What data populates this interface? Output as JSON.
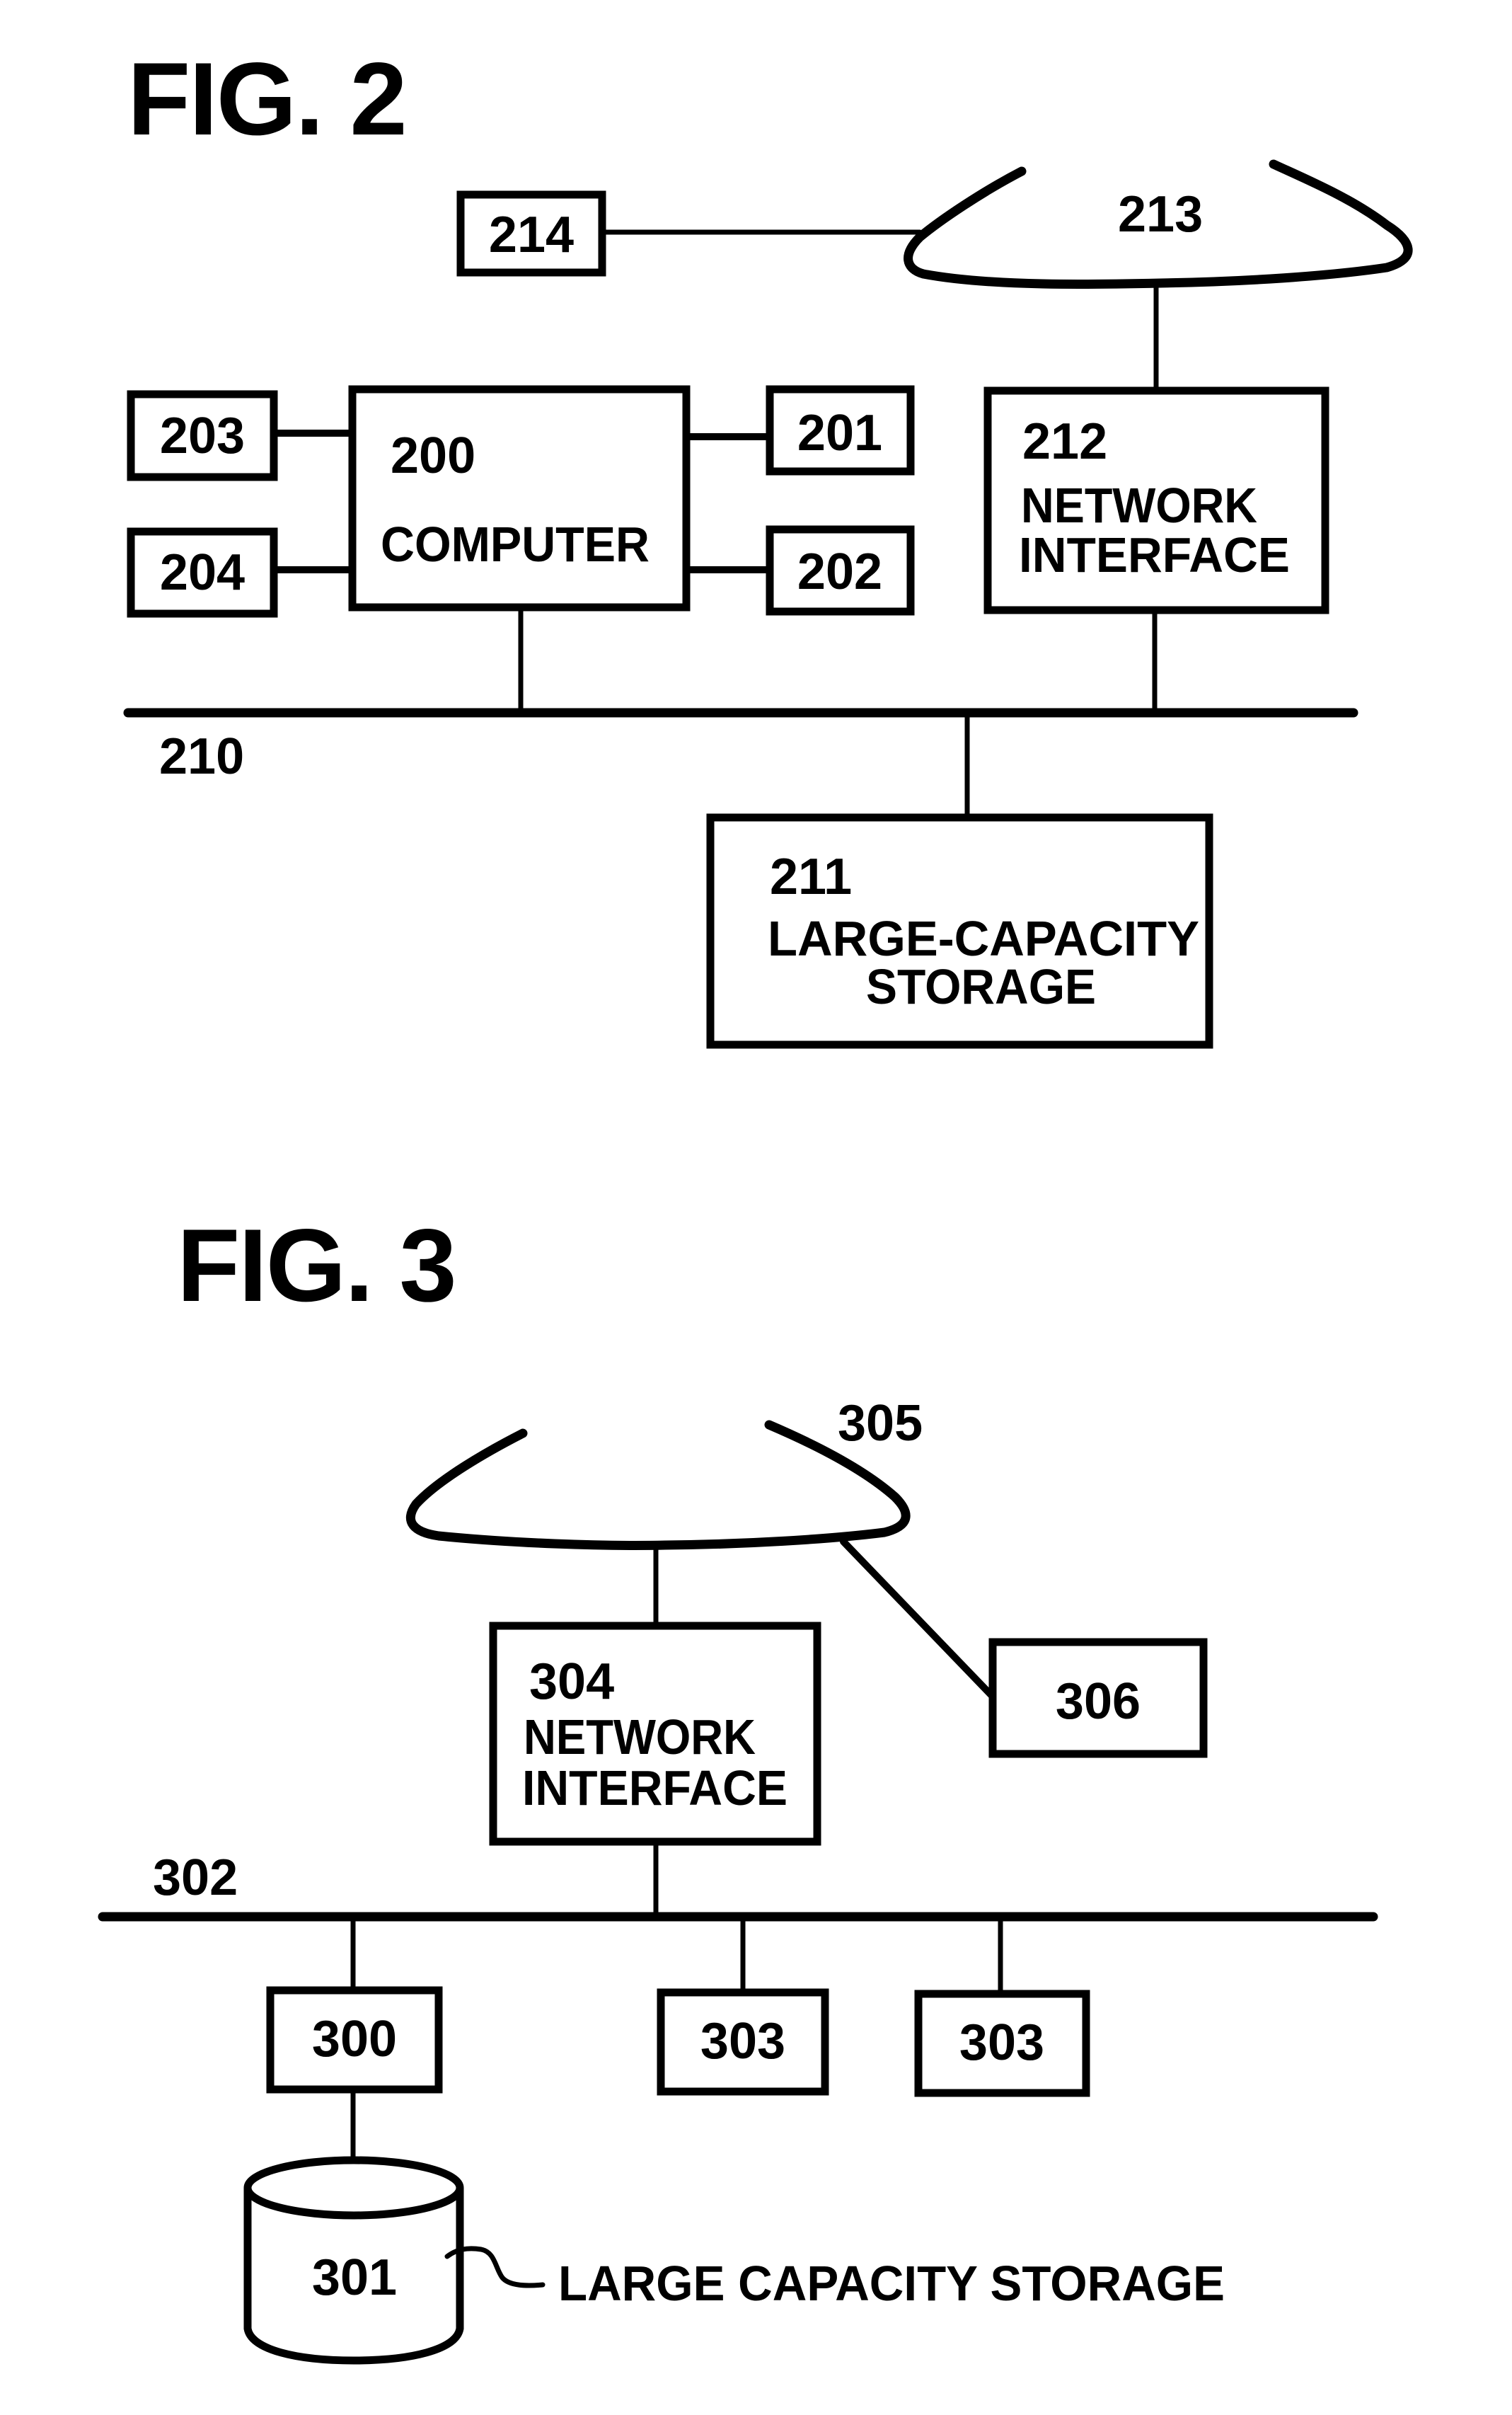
{
  "document": {
    "type": "patent-drawing-sheet",
    "background_color": "#ffffff",
    "ink_color": "#000000"
  },
  "fig2": {
    "title": "FIG. 2",
    "computer": {
      "ref": "200",
      "label": "COMPUTER"
    },
    "peripherals": [
      {
        "ref": "201"
      },
      {
        "ref": "202"
      },
      {
        "ref": "203"
      },
      {
        "ref": "204"
      }
    ],
    "bus": {
      "ref": "210"
    },
    "storage": {
      "ref": "211",
      "label_line1": "LARGE-CAPACITY",
      "label_line2": "STORAGE"
    },
    "network_interface": {
      "ref": "212",
      "label_line1": "NETWORK",
      "label_line2": "INTERFACE"
    },
    "network": {
      "ref": "213"
    },
    "remote_device": {
      "ref": "214"
    }
  },
  "fig3": {
    "title": "FIG. 3",
    "server": {
      "ref": "300"
    },
    "storage": {
      "ref": "301",
      "callout": "LARGE CAPACITY STORAGE"
    },
    "bus": {
      "ref": "302"
    },
    "terminals": [
      {
        "ref": "303"
      },
      {
        "ref": "303"
      }
    ],
    "network_interface": {
      "ref": "304",
      "label_line1": "NETWORK",
      "label_line2": "INTERFACE"
    },
    "network": {
      "ref": "305"
    },
    "remote_device": {
      "ref": "306"
    }
  }
}
